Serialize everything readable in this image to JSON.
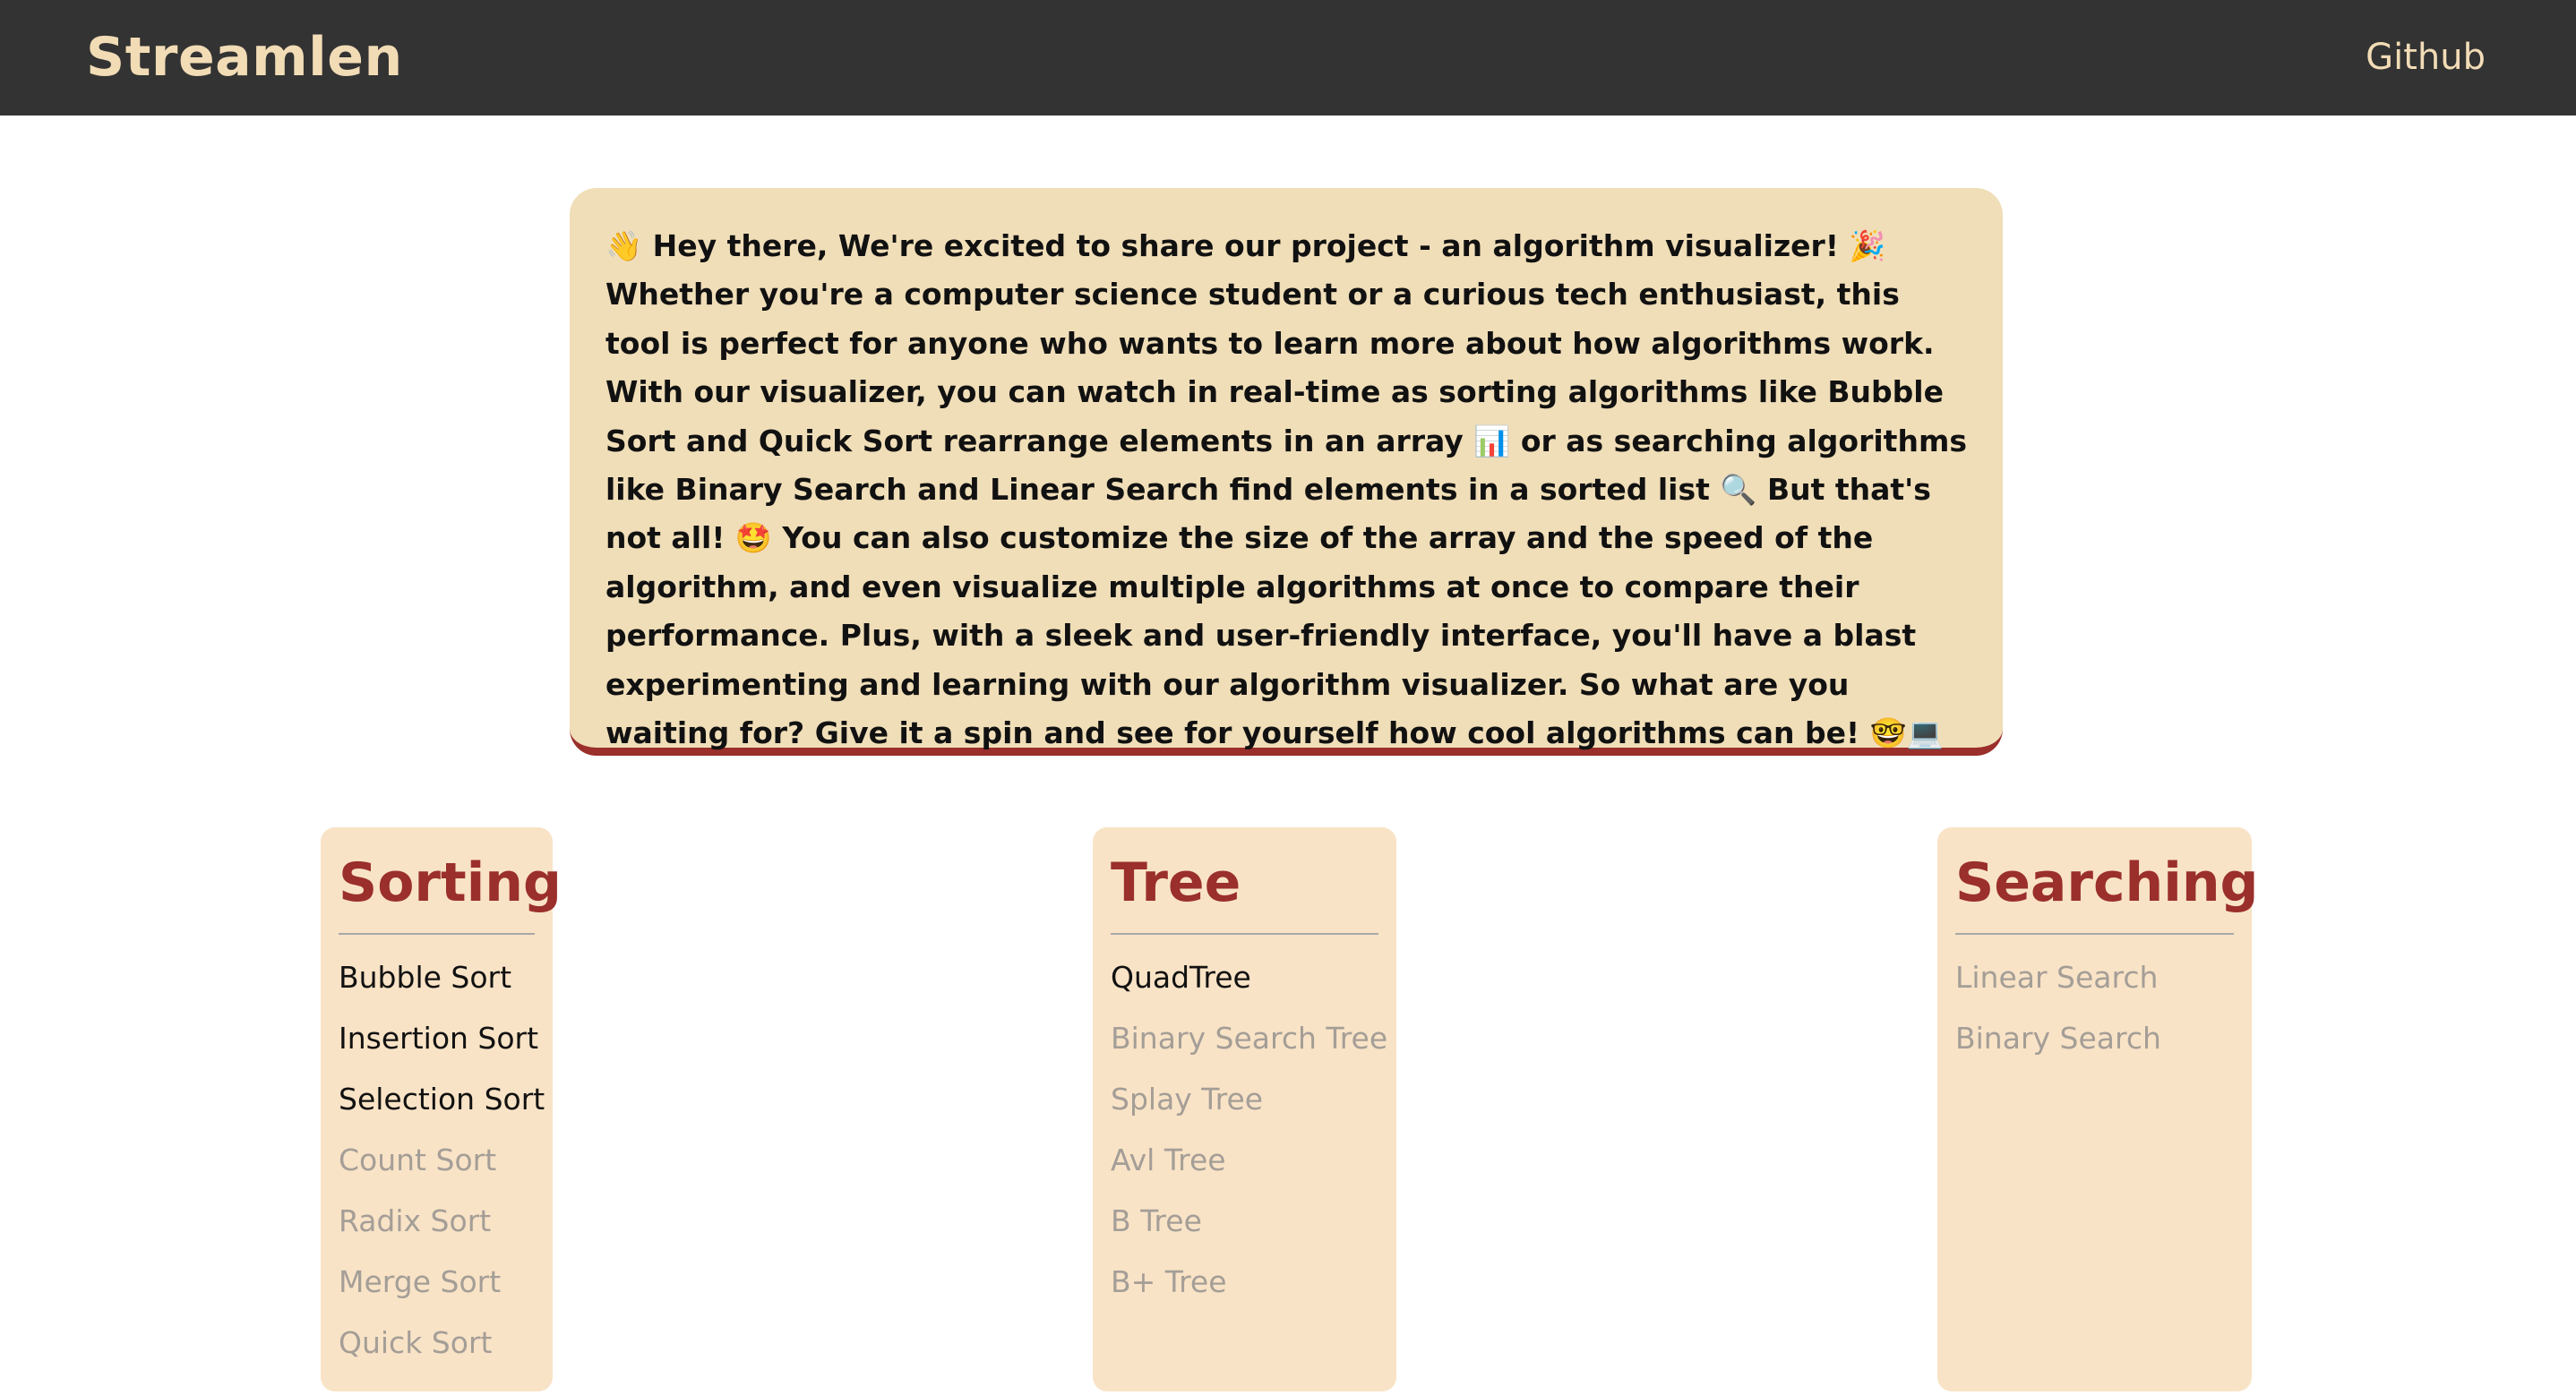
{
  "header": {
    "brand": "Streamlen",
    "github_label": "Github"
  },
  "intro": {
    "text": "👋 Hey there, We're excited to share our project - an algorithm visualizer! 🎉 Whether you're a computer science student or a curious tech enthusiast, this tool is perfect for anyone who wants to learn more about how algorithms work. With our visualizer, you can watch in real-time as sorting algorithms like Bubble Sort and Quick Sort rearrange elements in an array 📊 or as searching algorithms like Binary Search and Linear Search find elements in a sorted list 🔍 But that's not all! 🤩 You can also customize the size of the array and the speed of the algorithm, and even visualize multiple algorithms at once to compare their performance. Plus, with a sleek and user-friendly interface, you'll have a blast experimenting and learning with our algorithm visualizer. So what are you waiting for? Give it a spin and see for yourself how cool algorithms can be! 🤓💻"
  },
  "categories": {
    "sorting": {
      "title": "Sorting",
      "items": [
        {
          "label": "Bubble Sort",
          "enabled": true
        },
        {
          "label": "Insertion Sort",
          "enabled": true
        },
        {
          "label": "Selection Sort",
          "enabled": true
        },
        {
          "label": "Count Sort",
          "enabled": false
        },
        {
          "label": "Radix Sort",
          "enabled": false
        },
        {
          "label": "Merge Sort",
          "enabled": false
        },
        {
          "label": "Quick Sort",
          "enabled": false
        }
      ]
    },
    "tree": {
      "title": "Tree",
      "items": [
        {
          "label": "QuadTree",
          "enabled": true
        },
        {
          "label": "Binary Search Tree",
          "enabled": false
        },
        {
          "label": "Splay Tree",
          "enabled": false
        },
        {
          "label": "Avl Tree",
          "enabled": false
        },
        {
          "label": "B Tree",
          "enabled": false
        },
        {
          "label": "B+ Tree",
          "enabled": false
        }
      ]
    },
    "searching": {
      "title": "Searching",
      "items": [
        {
          "label": "Linear Search",
          "enabled": false
        },
        {
          "label": "Binary Search",
          "enabled": false
        }
      ]
    }
  },
  "colors": {
    "navbar": "#333333",
    "brand_text": "#f2dcb6",
    "intro_bg": "#f0deb8",
    "accent": "#9a2f2b",
    "card_bg": "#f9e3c6",
    "muted_text": "#a49e97"
  }
}
